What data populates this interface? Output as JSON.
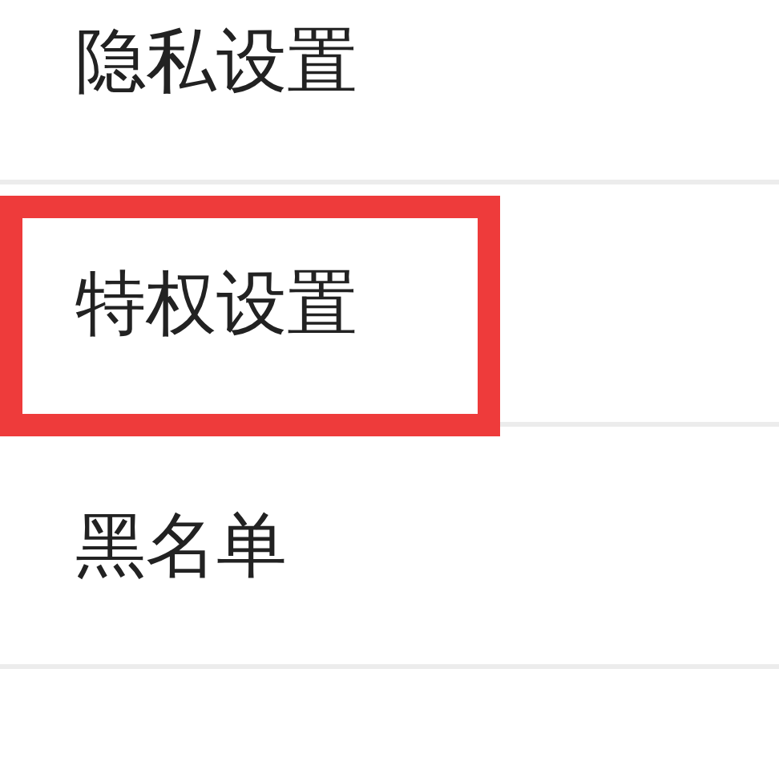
{
  "settings_items": [
    {
      "label": "隐私设置",
      "highlighted": false
    },
    {
      "label": "特权设置",
      "highlighted": true
    },
    {
      "label": "黑名单",
      "highlighted": false
    }
  ]
}
